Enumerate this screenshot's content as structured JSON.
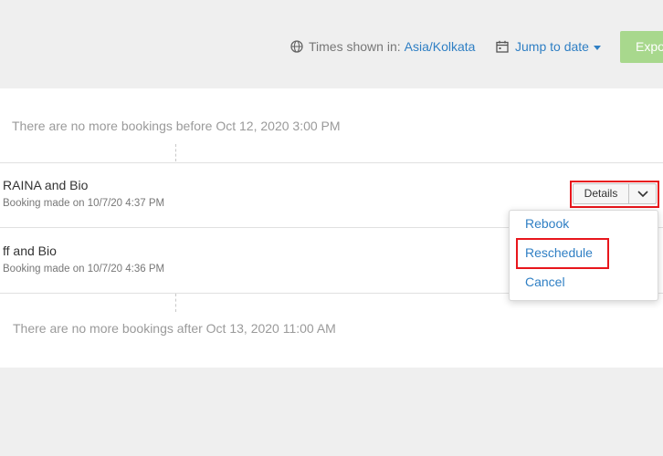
{
  "header": {
    "timezone_prefix": "Times shown in:",
    "timezone_value": "Asia/Kolkata",
    "jump_label": "Jump to date",
    "export_label": "Export",
    "icons": {
      "timezone": "globe-icon",
      "jump": "calendar-icon"
    }
  },
  "list": {
    "before_message": "There are no more bookings before Oct 12, 2020 3:00 PM",
    "after_message": "There are no more bookings after Oct 13, 2020 11:00 AM",
    "bookings": [
      {
        "title": "RAINA and Bio",
        "subtitle": "Booking made on 10/7/20 4:37 PM"
      },
      {
        "title": "ff and Bio",
        "subtitle": "Booking made on 10/7/20 4:36 PM"
      }
    ]
  },
  "actions": {
    "details_label": "Details",
    "menu": [
      "Rebook",
      "Reschedule",
      "Cancel"
    ]
  },
  "colors": {
    "background": "#efefef",
    "link": "#2f7fc4",
    "export": "#a8d88d",
    "highlight": "#e8161c"
  }
}
